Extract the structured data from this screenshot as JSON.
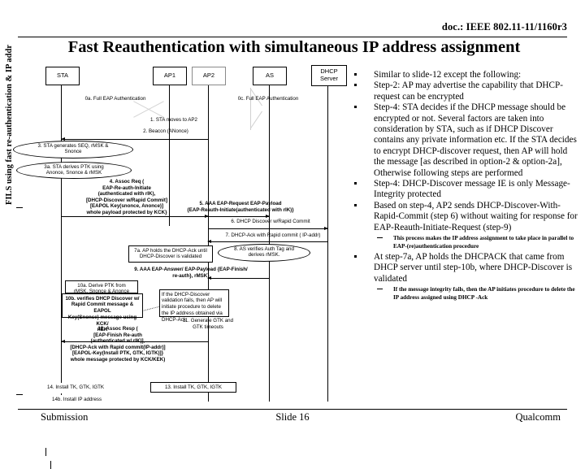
{
  "header": {
    "doc_id": "doc.: IEEE 802.11-11/1160r3",
    "title": "Fast Reauthentication with simultaneous IP address assignment"
  },
  "footer": {
    "left": "Submission",
    "center": "Slide 16",
    "right": "Qualcomm"
  },
  "sidebar": {
    "vertical_label": "FILS using fast re-authentication & IP addr"
  },
  "diagram": {
    "entities": [
      {
        "label": "STA"
      },
      {
        "label": "AP1"
      },
      {
        "label": "AP2"
      },
      {
        "label": "AS"
      },
      {
        "label": "DHCP\nServer"
      }
    ],
    "messages": [
      {
        "id": "m0a",
        "text": "0a. Full EAP Authentication"
      },
      {
        "id": "m0c",
        "text": "0c. Full EAP Authentication"
      },
      {
        "id": "m1",
        "text": "1. STA moves to AP2"
      },
      {
        "id": "m2",
        "text": "2. Beacon (ANonce)"
      },
      {
        "id": "m4",
        "text": "4. Assoc Req (\nEAP-Re-auth-Initiate\n(authenticated with rIK),\n[DHCP-Discover w/Rapid Commit]\n[EAPOL Key(snonce, Anonce)]\nwhole payload protected by KCK}"
      },
      {
        "id": "m5",
        "text": "5. AAA EAP-Request EAP-Payload\n{EAP-Reauth-Initiate(authenticated with rIK)}"
      },
      {
        "id": "m6",
        "text": "6. DHCP Discover w/Rapid Commit"
      },
      {
        "id": "m7",
        "text": "7. DHCP-Ack with Rapid commit ( IP-addr)"
      },
      {
        "id": "m9",
        "text": "9. AAA EAP-Answer/ EAP-Payload {EAP-Finish/\nre-auth}, rMSK}"
      },
      {
        "id": "m11",
        "text": "11. Generate GTK and\nGTK timeouts"
      },
      {
        "id": "m12",
        "text": "12. Assoc Resp (\n[EAP-Finish Re-auth\n(authenticated w/ rIK)],\n[DHCP-Ack with Rapid commit(IP-addr)]\n[EAPOL-Key(Install PTK, GTK, IGTK)]}\nwhole message protected by KCK/KEK)"
      }
    ],
    "notes": [
      {
        "id": "n3",
        "text": "3. STA generates SEQ, rMSK &\nSnonce"
      },
      {
        "id": "n3a",
        "text": "3a. STA derives PTK using\nAnonce, Snonce & rMSK"
      },
      {
        "id": "n7a",
        "text": "7a. AP holds the DHCP-Ack until\nDHCP-Discover is validated"
      },
      {
        "id": "n8",
        "text": "8. AS verifies Auth Tag and\nderives rMSK."
      },
      {
        "id": "n10a",
        "text": "10a. Derive PTK from\nrMSK, Snonce & Anonce"
      },
      {
        "id": "n10b",
        "text": "10b. verifies DHCP Discover w/\nRapid Commit message & EAPOL\nKey(Snonce) message using KCK/\nrIEK"
      },
      {
        "id": "nfail",
        "text": "If the DHCP-Discover\nvalidation fails, then AP will\ninitiate procedure to delete\nthe IP address obtained via\nDHCP-Ack"
      },
      {
        "id": "n14",
        "text": "14. Install TK, GTK, IGTK"
      },
      {
        "id": "n14b",
        "text": "14b. Install IP address"
      },
      {
        "id": "n13",
        "text": "13. Install TK, GTK, IGTK"
      }
    ]
  },
  "bullets": [
    {
      "level": 1,
      "text": "Similar to slide-12 except  the following:"
    },
    {
      "level": 1,
      "text": "Step-2: AP may advertise the capability that DHCP-request can be encrypted"
    },
    {
      "level": 1,
      "text": "Step-4: STA decides if the DHCP message should be encrypted or not. Several factors are taken into consideration by STA, such as if DHCP Discover contains any private information etc. If the STA decides to encrypt DHCP-discover request, then AP will hold the message [as described in option-2 & option-2a], Otherwise following steps are performed"
    },
    {
      "level": 1,
      "text": "Step-4: DHCP-Discover message IE is only Message-Integrity protected"
    },
    {
      "level": 1,
      "text": "Based on step-4, AP2 sends DHCP-Discover-With-Rapid-Commit (step 6)  without waiting for response for EAP-Reauth-Initiate-Request (step-9)"
    },
    {
      "level": 2,
      "text": "This process makes the  IP address assignment to take place in parallel to EAP-(re)authentication procedure"
    },
    {
      "level": 1,
      "text": "At step-7a, AP holds the DHCPACK that came from DHCP server until step-10b, where DHCP-Discover is validated"
    },
    {
      "level": 2,
      "text": "If the message integrity fails, then the  AP initiates procedure to delete the IP address assigned using DHCP -Ack"
    }
  ]
}
